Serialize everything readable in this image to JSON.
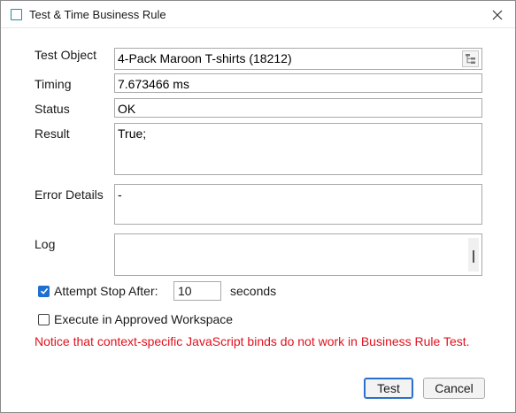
{
  "window": {
    "title": "Test & Time Business Rule"
  },
  "form": {
    "test_object_label": "Test Object",
    "test_object_value": "4-Pack Maroon T-shirts (18212)",
    "timing_label": "Timing",
    "timing_value": "7.673466 ms",
    "status_label": "Status",
    "status_value": "OK",
    "result_label": "Result",
    "result_value": "True;",
    "error_label": "Error Details",
    "error_value": "-",
    "log_label": "Log",
    "log_value": ""
  },
  "options": {
    "attempt_stop_label": "Attempt Stop After:",
    "attempt_stop_checked": true,
    "attempt_stop_value": "10",
    "seconds_label": "seconds",
    "approved_workspace_label": "Execute in Approved Workspace",
    "approved_workspace_checked": false
  },
  "notice": "Notice that context-specific JavaScript binds do not work in Business Rule Test.",
  "buttons": {
    "test": "Test",
    "cancel": "Cancel"
  },
  "colors": {
    "notice": "#e0101c",
    "accent": "#1f6fd1",
    "title_icon": "#1a8fa0"
  },
  "icons": [
    "window-icon",
    "close-icon",
    "tree-browse-icon",
    "checkmark-icon"
  ]
}
